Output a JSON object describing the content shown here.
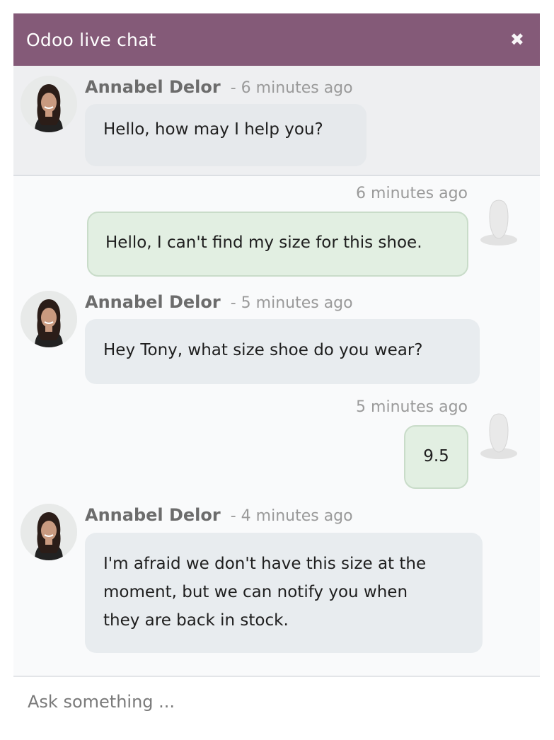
{
  "header": {
    "title": "Odoo live chat",
    "close_icon": "close-icon",
    "color": "#845a78"
  },
  "messages": [
    {
      "type": "operator",
      "author": "Annabel Delor",
      "time": "- 6 minutes ago",
      "text": "Hello, how may I help you?"
    },
    {
      "type": "visitor",
      "time": "6 minutes ago",
      "text": "Hello, I can't find my size for this shoe."
    },
    {
      "type": "operator",
      "author": "Annabel Delor",
      "time": "- 5 minutes ago",
      "text": "Hey Tony, what size shoe do you wear?"
    },
    {
      "type": "visitor",
      "time": "5 minutes ago",
      "text": "9.5"
    },
    {
      "type": "operator",
      "author": "Annabel Delor",
      "time": "- 4 minutes ago",
      "lines": [
        "I'm afraid we don't have this size at the",
        "moment, but we can notify you when",
        "they are back in stock."
      ]
    }
  ],
  "composer": {
    "placeholder": "Ask something ..."
  }
}
